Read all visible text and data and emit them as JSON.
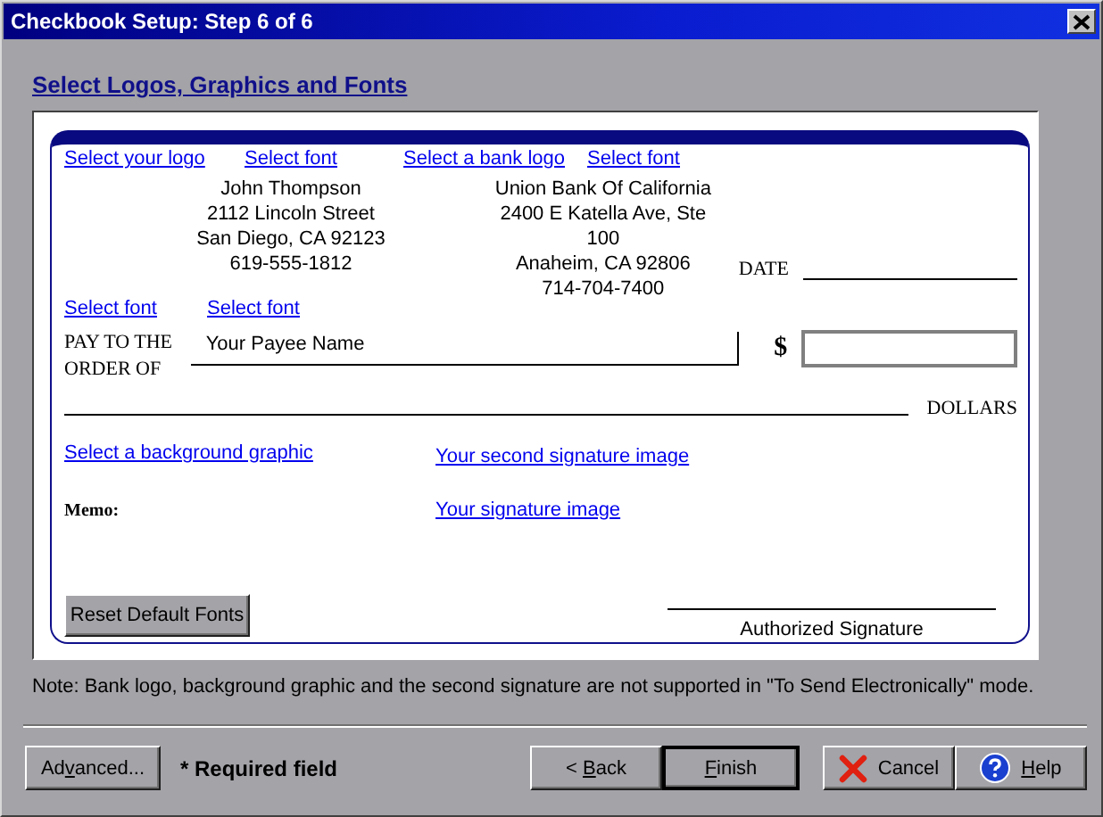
{
  "window": {
    "title": "Checkbook Setup: Step 6 of 6"
  },
  "heading": "Select Logos, Graphics and Fonts",
  "check": {
    "top_links": [
      "Select your logo",
      "Select font",
      "Select a bank logo",
      "Select font"
    ],
    "owner_address": [
      "John Thompson",
      "2112  Lincoln Street",
      "San Diego, CA 92123",
      "619-555-1812"
    ],
    "bank_address": [
      "Union Bank Of California",
      "2400 E Katella Ave, Ste",
      "100",
      "Anaheim, CA 92806",
      "714-704-7400"
    ],
    "date_label": "DATE",
    "font_links": [
      "Select font",
      "Select font"
    ],
    "payee_label": "PAY TO THE ORDER OF",
    "payee_value": "Your Payee Name",
    "dollar_sign": "$",
    "dollars_label": "DOLLARS",
    "background_link": "Select a background graphic",
    "second_signature_link": "Your second signature image",
    "memo_label": "Memo:",
    "signature_link": "Your signature image",
    "reset_button": "Reset Default Fonts",
    "signature_label": "Authorized Signature"
  },
  "note": "Note: Bank logo, background graphic and the second signature are not supported in \"To Send Electronically\" mode.",
  "advanced_button": {
    "before": "Ad",
    "key": "v",
    "after": "anced..."
  },
  "required_note": "* Required field",
  "nav_buttons": [
    {
      "kind": "plain",
      "before": "< ",
      "key": "B",
      "after": "ack",
      "default": false
    },
    {
      "kind": "plain",
      "key": "F",
      "after": "inish",
      "default": true
    },
    {
      "kind": "cancel",
      "before": "Cancel",
      "default": false
    },
    {
      "kind": "help",
      "key": "H",
      "after": "elp",
      "default": false
    }
  ]
}
